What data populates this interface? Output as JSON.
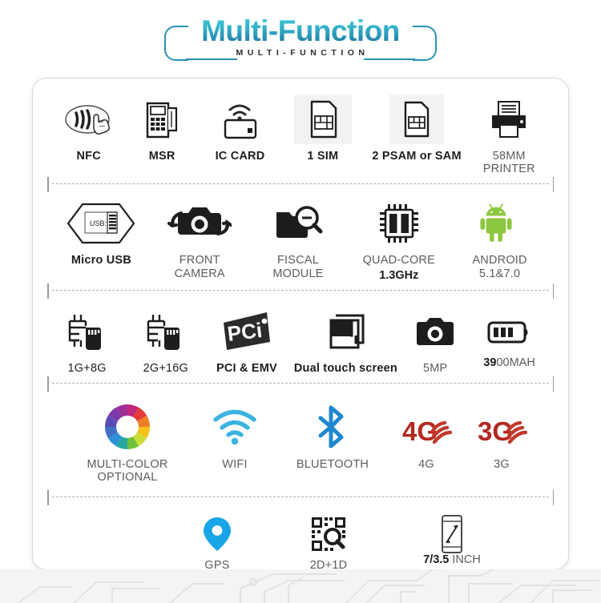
{
  "header": {
    "title_main": "Multi-Function",
    "title_sub": "MULTI-FUNCTION",
    "accent_color": "#2a93b6"
  },
  "card": {
    "rows": [
      {
        "id": "row-1",
        "cells": [
          {
            "icon": "nfc-icon",
            "label": "NFC",
            "style": "bold"
          },
          {
            "icon": "pos-terminal-icon",
            "label": "MSR",
            "style": "bold"
          },
          {
            "icon": "contactless-card-icon",
            "label": "IC CARD",
            "style": "bold"
          },
          {
            "icon": "sim-card-icon",
            "label": "1  SIM",
            "style": "bold",
            "shaded": true
          },
          {
            "icon": "psam-card-icon",
            "label": "2 PSAM or SAM",
            "style": "bold",
            "shaded": true
          },
          {
            "icon": "printer-icon",
            "label": "58MM\nPRINTER",
            "style": "plain"
          }
        ]
      },
      {
        "id": "row-2",
        "cells": [
          {
            "icon": "micro-usb-icon",
            "label": "Micro USB",
            "style": "bold"
          },
          {
            "icon": "front-camera-icon",
            "label": "FRONT\nCAMERA",
            "style": "plain"
          },
          {
            "icon": "fiscal-module-icon",
            "label": "FISCAL\nMODULE",
            "style": "plain"
          },
          {
            "icon": "quad-core-icon",
            "label": "QUAD-CORE",
            "style": "plain",
            "sublabel": "1.3GHz"
          },
          {
            "icon": "android-icon",
            "label": "ANDROID\n5.1&7.0",
            "style": "plain"
          }
        ]
      },
      {
        "id": "row-3",
        "cells": [
          {
            "icon": "memory-1g8g-icon",
            "label": "1G+8G",
            "style": "dark"
          },
          {
            "icon": "memory-2g16g-icon",
            "label": "2G+16G",
            "style": "dark"
          },
          {
            "icon": "pci-logo-icon",
            "label": "PCI & EMV",
            "style": "bold"
          },
          {
            "icon": "dual-screen-icon",
            "label": "Dual touch screen",
            "style": "bold"
          },
          {
            "icon": "camera-5mp-icon",
            "label": "5MP",
            "style": "plain"
          },
          {
            "icon": "battery-icon",
            "label_rich": [
              {
                "t": "39",
                "b": true
              },
              {
                "t": "00MAH",
                "b": false
              }
            ],
            "label": "3900MAH",
            "style": "mixed"
          }
        ]
      },
      {
        "id": "row-4",
        "cells": [
          {
            "icon": "color-wheel-icon",
            "label": "MULTI-COLOR\nOPTIONAL",
            "style": "plain"
          },
          {
            "icon": "wifi-icon",
            "label": "WIFI",
            "style": "plain"
          },
          {
            "icon": "bluetooth-icon",
            "label": "BLUETOOTH",
            "style": "plain"
          },
          {
            "icon": "4g-signal-icon",
            "label": "4G",
            "style": "plain"
          },
          {
            "icon": "3g-signal-icon",
            "label": "3G",
            "style": "plain"
          }
        ]
      },
      {
        "id": "row-5",
        "cells": [
          {
            "icon": "gps-pin-icon",
            "label": "GPS",
            "style": "plain"
          },
          {
            "icon": "qr-scan-icon",
            "label": "2D+1D",
            "style": "plain"
          },
          {
            "icon": "screen-size-icon",
            "label_rich": [
              {
                "t": "7/3.5 ",
                "b": true
              },
              {
                "t": "INCH",
                "b": false
              }
            ],
            "label": "7/3.5 INCH",
            "style": "mixed"
          }
        ]
      }
    ]
  },
  "colors": {
    "icon_dark": "#1d1d1d",
    "label_gray": "#5c5c5c",
    "android_green": "#8dc63f",
    "wifi_blue": "#3bb3e0",
    "bluetooth_blue": "#1e88d0",
    "signal_red": "#c0392b",
    "gps_blue": "#19a6e8",
    "card_border": "#d8d8d8"
  }
}
